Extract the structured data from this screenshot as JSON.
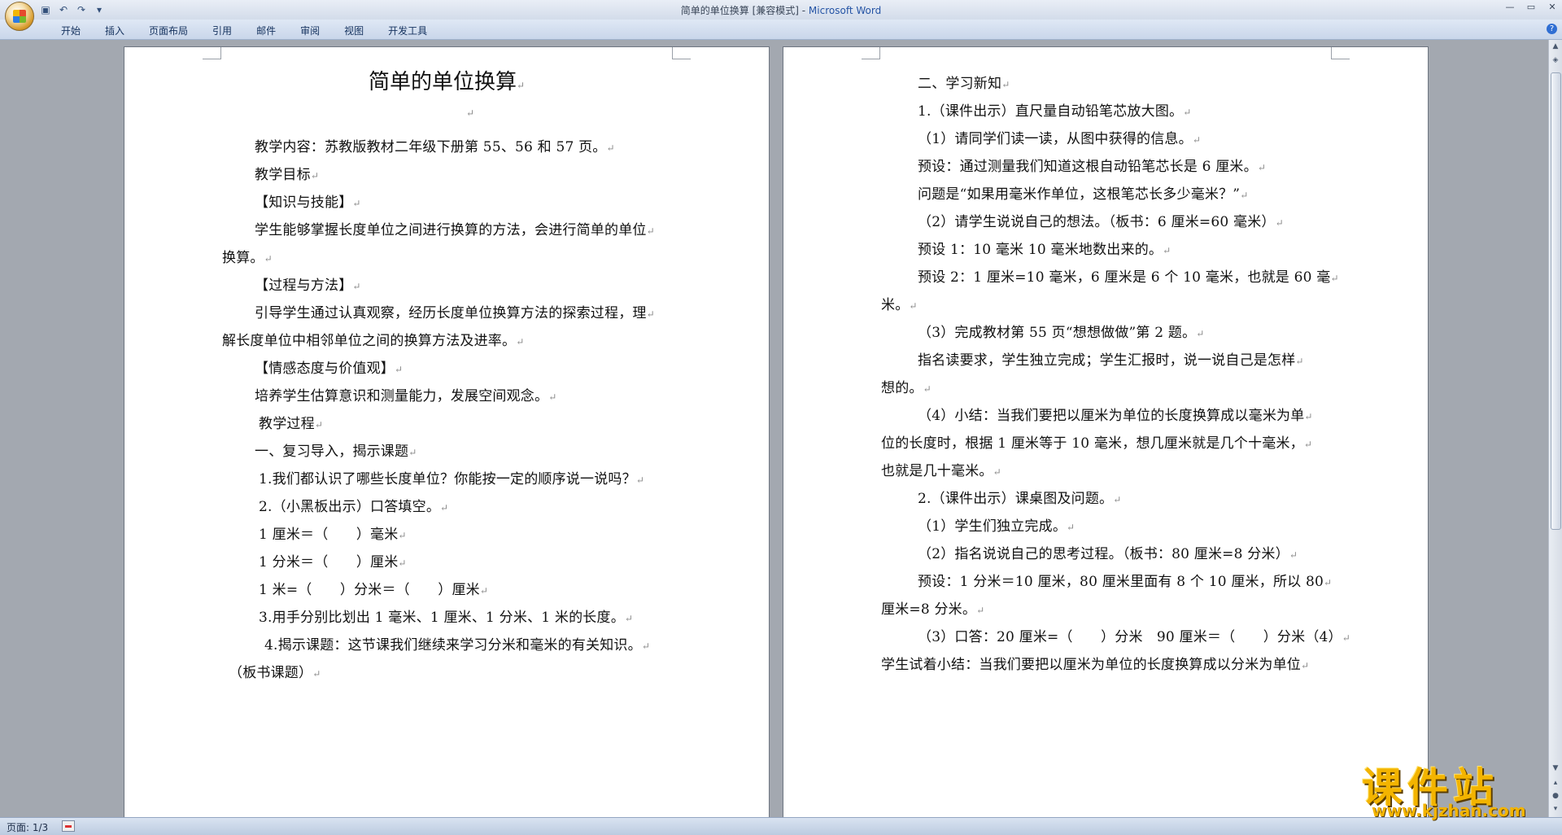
{
  "window": {
    "title": "简单的单位换算 [兼容模式] - ",
    "app_name": "Microsoft Word"
  },
  "quick_access": [
    "save-icon",
    "undo-icon",
    "redo-icon",
    "customize-icon"
  ],
  "ribbon": {
    "tabs": [
      "开始",
      "插入",
      "页面布局",
      "引用",
      "邮件",
      "审阅",
      "视图",
      "开发工具"
    ]
  },
  "document": {
    "title": "简单的单位换算",
    "page1": [
      "",
      "教学内容：苏教版教材二年级下册第 55、56 和 57 页。",
      "教学目标",
      "【知识与技能】",
      "学生能够掌握长度单位之间进行换算的方法，会进行简单的单位",
      "换算。",
      "【过程与方法】",
      "引导学生通过认真观察，经历长度单位换算方法的探索过程，理",
      "解长度单位中相邻单位之间的换算方法及进率。",
      "【情感态度与价值观】",
      "培养学生估算意识和测量能力，发展空间观念。",
      "教学过程",
      "一、复习导入，揭示课题",
      "1.我们都认识了哪些长度单位？你能按一定的顺序说一说吗？",
      "2.（小黑板出示）口答填空。",
      "1 厘米＝（　　）毫米",
      "1 分米＝（　　）厘米",
      "1 米=（　　）分米＝（　　）厘米",
      "3.用手分别比划出 1 毫米、1 厘米、1 分米、1 米的长度。",
      "4.揭示课题：这节课我们继续来学习分米和毫米的有关知识。",
      "（板书课题）"
    ],
    "page2": [
      "二、学习新知",
      "1.（课件出示）直尺量自动铅笔芯放大图。",
      "（1）请同学们读一读，从图中获得的信息。",
      "预设：通过测量我们知道这根自动铅笔芯长是 6 厘米。",
      "问题是“如果用毫米作单位，这根笔芯长多少毫米？”",
      "（2）请学生说说自己的想法。（板书：6 厘米=60 毫米）",
      "预设 1：10 毫米 10 毫米地数出来的。",
      "预设 2：1 厘米=10 毫米，6 厘米是 6 个 10 毫米，也就是 60 毫",
      "米。",
      "（3）完成教材第 55 页“想想做做”第 2 题。",
      "指名读要求，学生独立完成；学生汇报时，说一说自己是怎样",
      "想的。",
      "（4）小结：当我们要把以厘米为单位的长度换算成以毫米为单",
      "位的长度时，根据 1 厘米等于 10 毫米，想几厘米就是几个十毫米，",
      "也就是几十毫米。",
      "2.（课件出示）课桌图及问题。",
      "（1）学生们独立完成。",
      "（2）指名说说自己的思考过程。（板书：80 厘米=8 分米）",
      "预设：1 分米＝10 厘米，80 厘米里面有 8 个 10 厘米，所以 80",
      "厘米=8 分米。",
      "（3）口答：20 厘米=（　　）分米　90 厘米＝（　　）分米（4）",
      "学生试着小结：当我们要把以厘米为单位的长度换算成以分米为单位"
    ]
  },
  "status": {
    "page": "页面: 1/3"
  },
  "watermark": {
    "text": "课件站",
    "url": "www.kjzhan.com"
  }
}
